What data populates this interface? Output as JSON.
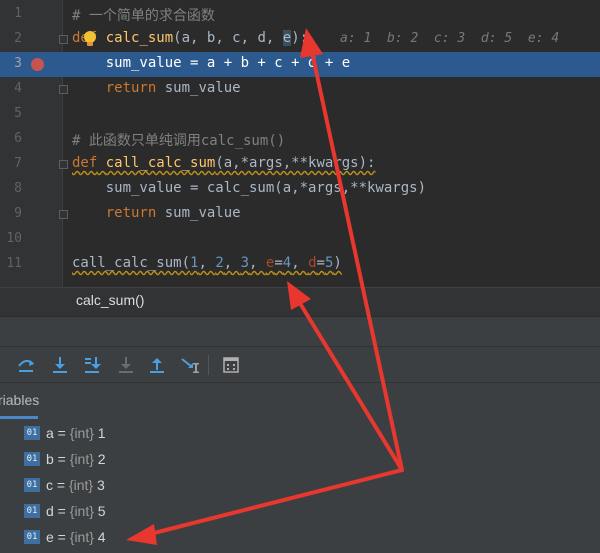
{
  "editor": {
    "line_numbers": [
      "1",
      "2",
      "3",
      "4",
      "5",
      "6",
      "7",
      "8",
      "9",
      "10",
      "11"
    ],
    "line1": {
      "comment": "# 一个简单的求合函数"
    },
    "line2": {
      "def": "def",
      "space": " ",
      "name": "calc_sum",
      "open": "(",
      "params": "a, b, c, d, ",
      "param_e": "e",
      "close": "):",
      "inline_values": "a: 1  b: 2  c: 3  d: 5  e: 4"
    },
    "line3": {
      "code": "    sum_value = a + b + c + d + e"
    },
    "line4": {
      "ret": "    return",
      "rest": " sum_value"
    },
    "line6": {
      "comment": "# 此函数只单纯调用calc_sum()"
    },
    "line7": {
      "def": "def",
      "space": " ",
      "name": "call_calc_sum",
      "rest": "(a,*args,**kwargs):"
    },
    "line8": {
      "code": "    sum_value = calc_sum(a,*args,**kwargs)"
    },
    "line9": {
      "ret": "    return",
      "rest": " sum_value"
    },
    "line11": {
      "name": "call_calc_sum(",
      "n1": "1",
      "c1": ", ",
      "n2": "2",
      "c2": ", ",
      "n3": "3",
      "c3": ", ",
      "pe": "e",
      "eq1": "=",
      "v4": "4",
      "c4": ", ",
      "pd": "d",
      "eq2": "=",
      "v5": "5",
      "close": ")"
    }
  },
  "hint": {
    "text": "calc_sum()"
  },
  "debug": {
    "toolbar_icons": [
      "step-over-icon",
      "step-into-icon",
      "step-into-my-code-icon",
      "force-step-into-icon",
      "step-out-icon",
      "run-to-cursor-icon",
      "evaluate-expression-icon"
    ],
    "tab_label": "riables",
    "variables": [
      {
        "badge": "01",
        "name": "a",
        "eq": " = ",
        "type": "{int}",
        "value": " 1"
      },
      {
        "badge": "01",
        "name": "b",
        "eq": " = ",
        "type": "{int}",
        "value": " 2"
      },
      {
        "badge": "01",
        "name": "c",
        "eq": " = ",
        "type": "{int}",
        "value": " 3"
      },
      {
        "badge": "01",
        "name": "d",
        "eq": " = ",
        "type": "{int}",
        "value": " 5"
      },
      {
        "badge": "01",
        "name": "e",
        "eq": " = ",
        "type": "{int}",
        "value": " 4"
      }
    ]
  },
  "colors": {
    "background": "#2b2b2b",
    "current_line": "#2d5a8e",
    "breakpoint": "#c75450",
    "annotation_arrow": "#e8372e"
  }
}
